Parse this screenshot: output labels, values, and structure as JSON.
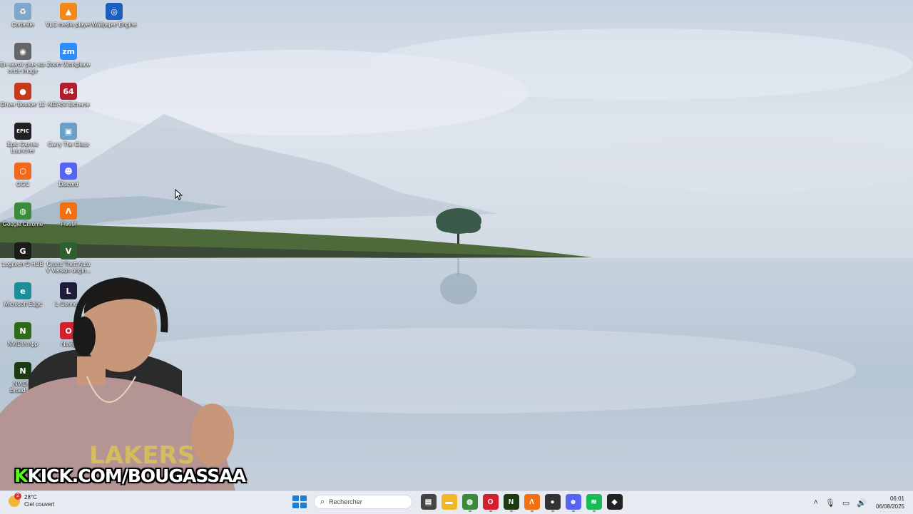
{
  "desktop": {
    "icons": [
      {
        "label": "Corbeille",
        "icon": "recycle-bin-icon",
        "color": "#7fa7c9",
        "glyph": "♻"
      },
      {
        "label": "VLC media player",
        "icon": "vlc-icon",
        "color": "#f08a1c",
        "glyph": "▲"
      },
      {
        "label": "Wallpaper Engine",
        "icon": "wallpaper-engine-icon",
        "color": "#1c5fbf",
        "glyph": "◎"
      },
      {
        "label": "En savoir plus sur cette image",
        "icon": "camera-info-icon",
        "color": "#666666",
        "glyph": "◉"
      },
      {
        "label": "Zoom Workplace",
        "icon": "zoom-icon",
        "color": "#2d8cff",
        "glyph": "zm"
      },
      {
        "label": "Driver Booster 12",
        "icon": "driver-booster-icon",
        "color": "#c43a1a",
        "glyph": "●"
      },
      {
        "label": "AIDA64 Extreme",
        "icon": "aida64-icon",
        "color": "#b01f2e",
        "glyph": "64"
      },
      {
        "label": "Epic Games Launcher",
        "icon": "epic-games-icon",
        "color": "#222222",
        "glyph": "EPIC"
      },
      {
        "label": "Carry The Glass",
        "icon": "carry-the-glass-icon",
        "color": "#6aa0c8",
        "glyph": "▣"
      },
      {
        "label": "GGC",
        "icon": "ggc-icon",
        "color": "#f06a1e",
        "glyph": "⬡"
      },
      {
        "label": "Discord",
        "icon": "discord-icon",
        "color": "#5865f2",
        "glyph": "☻"
      },
      {
        "label": "Google Chrome",
        "icon": "chrome-icon",
        "color": "#3c8b3c",
        "glyph": "◍"
      },
      {
        "label": "FiveM",
        "icon": "fivem-icon",
        "color": "#f2700f",
        "glyph": "Λ"
      },
      {
        "label": "Logitech G HUB",
        "icon": "logitech-ghub-icon",
        "color": "#1b1b1b",
        "glyph": "G"
      },
      {
        "label": "Grand Theft Auto V Version origin...",
        "icon": "gta-v-icon",
        "color": "#2f5f2f",
        "glyph": "V"
      },
      {
        "label": "Microsoft Edge",
        "icon": "edge-icon",
        "color": "#1a8f9a",
        "glyph": "e"
      },
      {
        "label": "L-Connect",
        "icon": "l-connect-icon",
        "color": "#1e1e3a",
        "glyph": "L"
      },
      {
        "label": "NVIDIA App",
        "icon": "nvidia-app-icon",
        "color": "#2f6b16",
        "glyph": "N"
      },
      {
        "label": "Navig",
        "icon": "opera-icon",
        "color": "#d3202f",
        "glyph": "O"
      },
      {
        "label": "NVIDIA Broadcast",
        "icon": "nvidia-broadcast-icon",
        "color": "#1d3b12",
        "glyph": "N"
      }
    ]
  },
  "overlay": {
    "kick_prefix": "K",
    "kick_text": "KICK.COM/BOUGASSAA"
  },
  "taskbar": {
    "weather_temp": "28°C",
    "weather_desc": "Ciel couvert",
    "weather_badge": "2",
    "search_placeholder": "Rechercher",
    "apps": [
      {
        "name": "task-view",
        "color": "#444444",
        "glyph": "▤"
      },
      {
        "name": "file-explorer",
        "color": "#f2b823",
        "glyph": "▬"
      },
      {
        "name": "chrome",
        "color": "#3c8b3c",
        "glyph": "◍"
      },
      {
        "name": "opera",
        "color": "#d3202f",
        "glyph": "O"
      },
      {
        "name": "nvidia-broadcast",
        "color": "#1d3b12",
        "glyph": "N"
      },
      {
        "name": "fivem",
        "color": "#f2700f",
        "glyph": "Λ"
      },
      {
        "name": "app-red-dot",
        "color": "#333333",
        "glyph": "●"
      },
      {
        "name": "discord",
        "color": "#5865f2",
        "glyph": "☻"
      },
      {
        "name": "spotify",
        "color": "#1db954",
        "glyph": "≋"
      },
      {
        "name": "steam-like",
        "color": "#222222",
        "glyph": "◆"
      }
    ],
    "time": "06:01",
    "date": "06/08/2025"
  }
}
